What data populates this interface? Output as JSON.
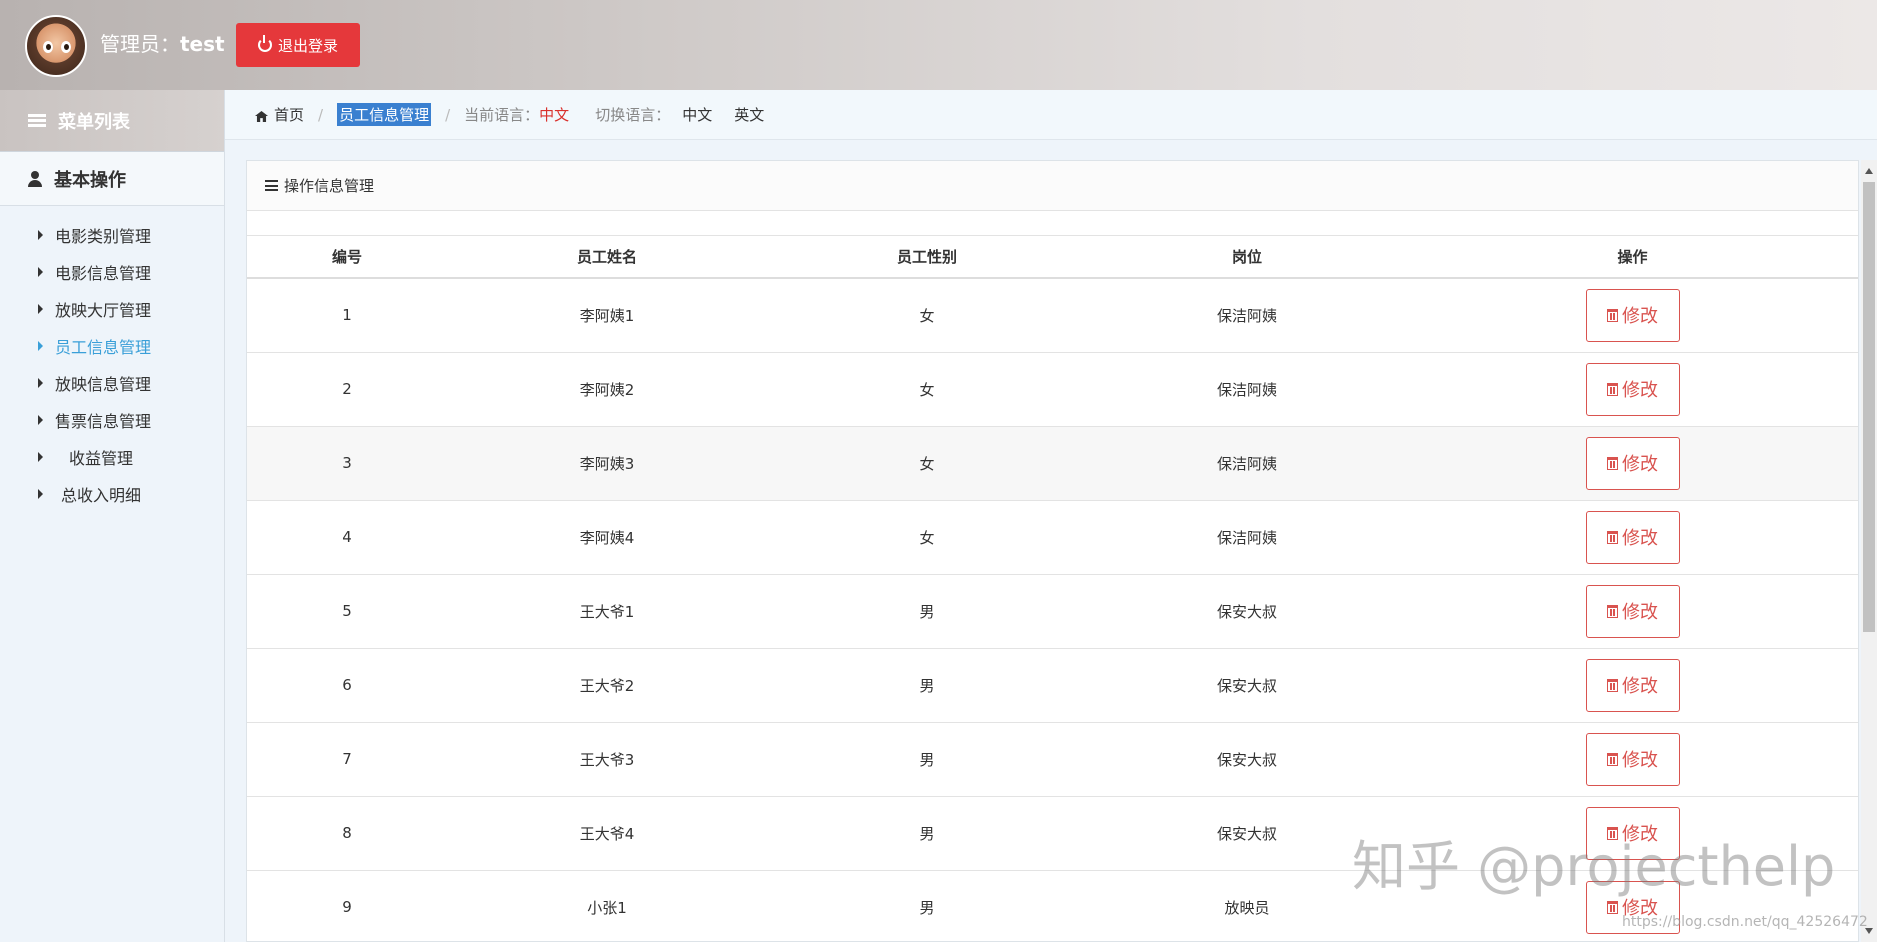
{
  "header": {
    "admin_prefix": "管理员：",
    "admin_name": "test",
    "logout_label": "退出登录"
  },
  "sidebar": {
    "menu_title": "菜单列表",
    "section_title": "基本操作",
    "items": [
      {
        "label": "电影类别管理"
      },
      {
        "label": "电影信息管理"
      },
      {
        "label": "放映大厅管理"
      },
      {
        "label": "员工信息管理"
      },
      {
        "label": "放映信息管理"
      },
      {
        "label": "售票信息管理"
      },
      {
        "label": "收益管理"
      },
      {
        "label": "总收入明细"
      }
    ],
    "active_item": "员工信息管理"
  },
  "breadcrumb": {
    "home": "首页",
    "current": "员工信息管理",
    "lang_label": "当前语言：",
    "lang_current": "中文",
    "switch_label": "切换语言：",
    "lang_zh": "中文",
    "lang_en": "英文"
  },
  "panel": {
    "title": "操作信息管理",
    "columns": [
      "编号",
      "员工姓名",
      "员工性别",
      "岗位",
      "操作"
    ],
    "edit_label": "修改",
    "rows": [
      {
        "id": "1",
        "name": "李阿姨1",
        "gender": "女",
        "post": "保洁阿姨"
      },
      {
        "id": "2",
        "name": "李阿姨2",
        "gender": "女",
        "post": "保洁阿姨"
      },
      {
        "id": "3",
        "name": "李阿姨3",
        "gender": "女",
        "post": "保洁阿姨"
      },
      {
        "id": "4",
        "name": "李阿姨4",
        "gender": "女",
        "post": "保洁阿姨"
      },
      {
        "id": "5",
        "name": "王大爷1",
        "gender": "男",
        "post": "保安大叔"
      },
      {
        "id": "6",
        "name": "王大爷2",
        "gender": "男",
        "post": "保安大叔"
      },
      {
        "id": "7",
        "name": "王大爷3",
        "gender": "男",
        "post": "保安大叔"
      },
      {
        "id": "8",
        "name": "王大爷4",
        "gender": "男",
        "post": "保安大叔"
      },
      {
        "id": "9",
        "name": "小张1",
        "gender": "男",
        "post": "放映员"
      }
    ]
  },
  "watermark": {
    "main": "知乎 @projecthelp",
    "small": "https://blog.csdn.net/qq_42526472"
  },
  "colors": {
    "accent": "#3a9fd8",
    "danger": "#d9534f",
    "logout": "#e5383b",
    "crumb_highlight": "#3a80d0"
  }
}
